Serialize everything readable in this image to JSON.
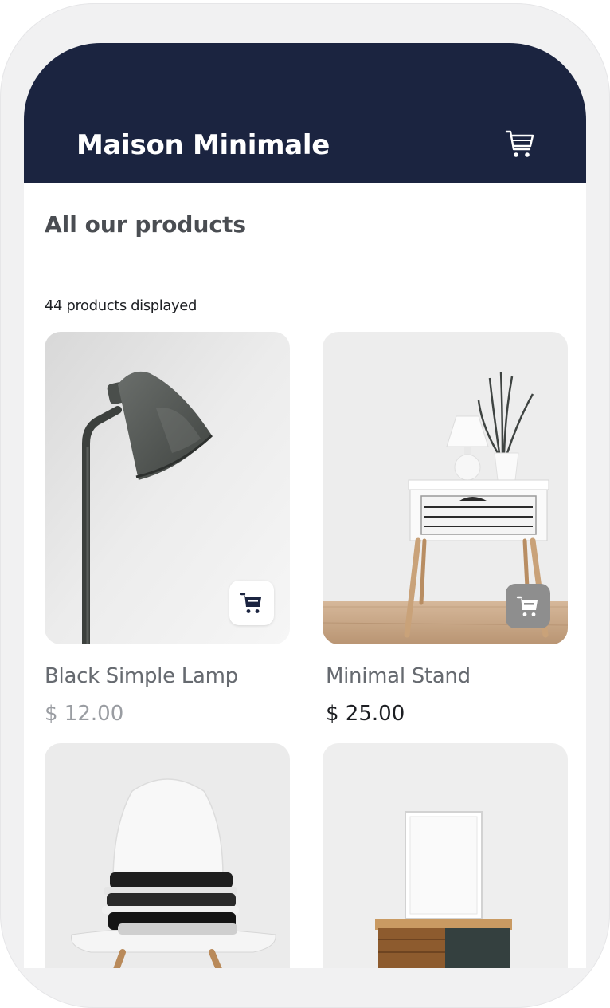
{
  "app": {
    "title": "Maison Minimale"
  },
  "header": {
    "cart_icon": "shopping-cart-icon"
  },
  "page": {
    "heading": "All our products",
    "count_text": "44 products displayed"
  },
  "colors": {
    "header_bg": "#1b2440",
    "price_muted": "#9a9da2",
    "price_dark": "#1d1f23",
    "add_button_gray": "#8e8e8e"
  },
  "products": [
    {
      "name": "Black Simple Lamp",
      "price": "$ 12.00",
      "add_icon": "cart-icon"
    },
    {
      "name": "Minimal Stand",
      "price": "$ 25.00",
      "add_icon": "cart-icon"
    },
    {
      "name": "",
      "price": ""
    },
    {
      "name": "",
      "price": ""
    }
  ]
}
